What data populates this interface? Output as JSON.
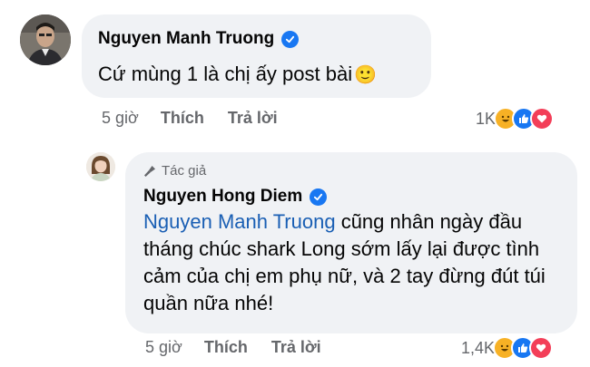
{
  "comment1": {
    "author": "Nguyen Manh Truong",
    "text": "Cứ mùng 1 là chị ấy post bài",
    "emoji": "🙂",
    "time": "5 giờ",
    "like_label": "Thích",
    "reply_label": "Trả lời",
    "reaction_count": "1K",
    "reactions": [
      "haha-icon",
      "like-icon",
      "love-icon"
    ]
  },
  "reply1": {
    "author_tag": "Tác giả",
    "author": "Nguyen Hong Diem",
    "mention": "Nguyen Manh Truong",
    "text_after_mention": " cũng nhân ngày đầu tháng chúc shark Long sớm lấy lại được tình cảm của chị em phụ nữ, và 2 tay đừng đút túi quần nữa nhé!",
    "time": "5 giờ",
    "like_label": "Thích",
    "reply_label": "Trả lời",
    "reaction_count": "1,4K",
    "reactions": [
      "haha-icon",
      "like-icon",
      "love-icon"
    ]
  },
  "colors": {
    "bubble": "#f0f2f5",
    "verified": "#1877f2",
    "mention": "#1a5fb4",
    "meta": "#65676b",
    "like": "#1877f2",
    "love": "#f33e58",
    "haha": "#f7b125"
  }
}
